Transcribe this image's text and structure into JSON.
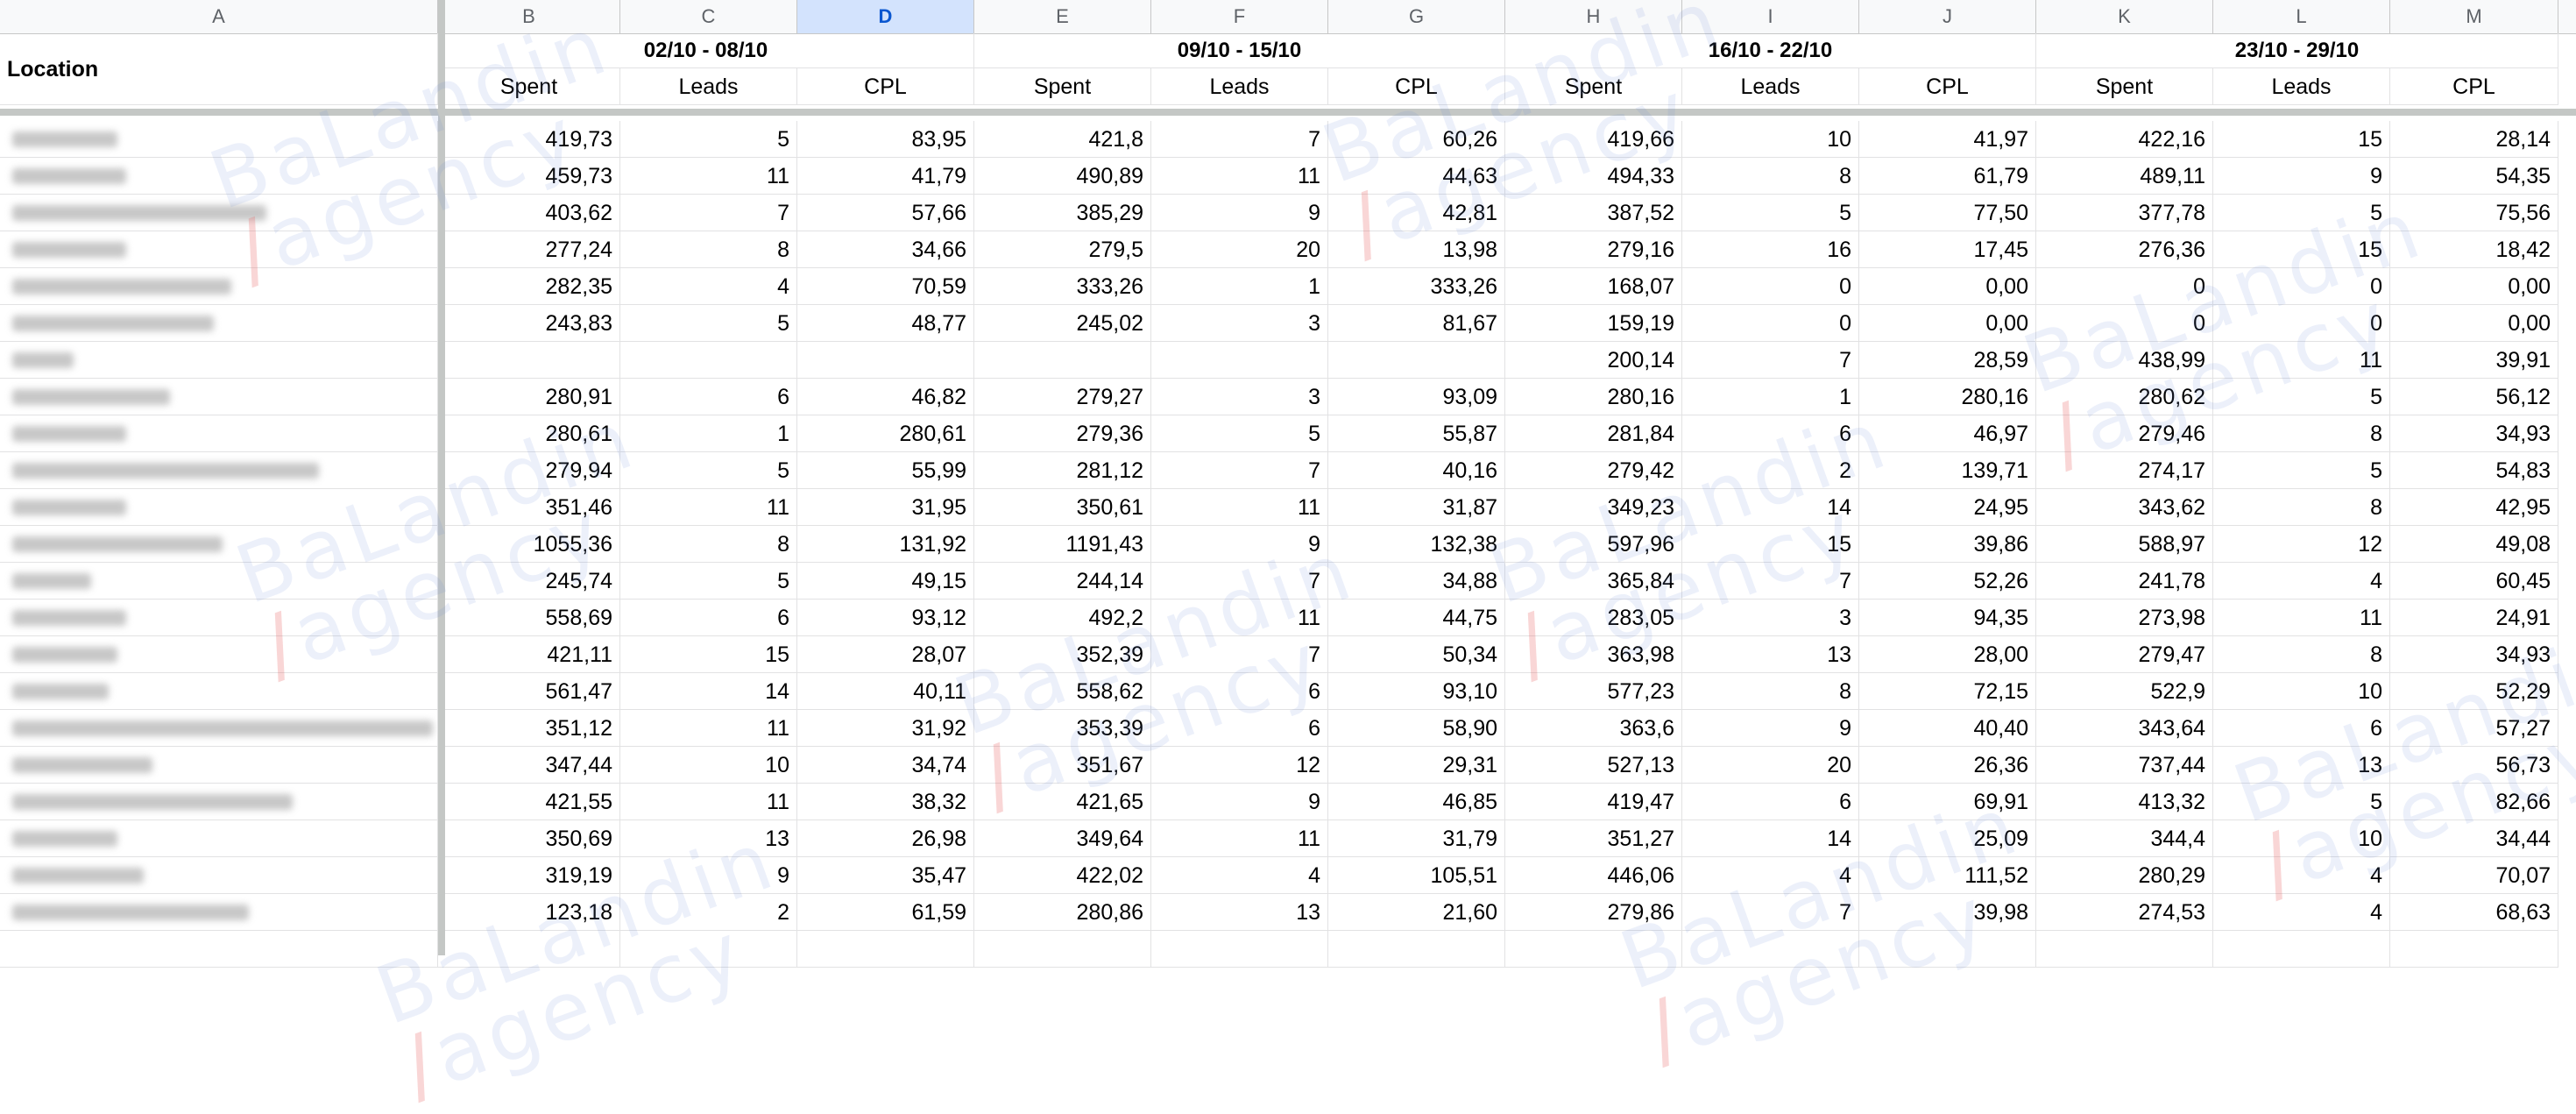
{
  "columns": [
    "A",
    "B",
    "C",
    "D",
    "E",
    "F",
    "G",
    "H",
    "I",
    "J",
    "K",
    "L",
    "M"
  ],
  "selected_column": "D",
  "header": {
    "location_label": "Location",
    "weeks": [
      "02/10 - 08/10",
      "09/10 - 15/10",
      "16/10 - 22/10",
      "23/10 - 29/10"
    ],
    "sub": [
      "Spent",
      "Leads",
      "CPL"
    ]
  },
  "rows": [
    [
      "419,73",
      "5",
      "83,95",
      "421,8",
      "7",
      "60,26",
      "419,66",
      "10",
      "41,97",
      "422,16",
      "15",
      "28,14"
    ],
    [
      "459,73",
      "11",
      "41,79",
      "490,89",
      "11",
      "44,63",
      "494,33",
      "8",
      "61,79",
      "489,11",
      "9",
      "54,35"
    ],
    [
      "403,62",
      "7",
      "57,66",
      "385,29",
      "9",
      "42,81",
      "387,52",
      "5",
      "77,50",
      "377,78",
      "5",
      "75,56"
    ],
    [
      "277,24",
      "8",
      "34,66",
      "279,5",
      "20",
      "13,98",
      "279,16",
      "16",
      "17,45",
      "276,36",
      "15",
      "18,42"
    ],
    [
      "282,35",
      "4",
      "70,59",
      "333,26",
      "1",
      "333,26",
      "168,07",
      "0",
      "0,00",
      "0",
      "0",
      "0,00"
    ],
    [
      "243,83",
      "5",
      "48,77",
      "245,02",
      "3",
      "81,67",
      "159,19",
      "0",
      "0,00",
      "0",
      "0",
      "0,00"
    ],
    [
      "",
      "",
      "",
      "",
      "",
      "",
      "200,14",
      "7",
      "28,59",
      "438,99",
      "11",
      "39,91"
    ],
    [
      "280,91",
      "6",
      "46,82",
      "279,27",
      "3",
      "93,09",
      "280,16",
      "1",
      "280,16",
      "280,62",
      "5",
      "56,12"
    ],
    [
      "280,61",
      "1",
      "280,61",
      "279,36",
      "5",
      "55,87",
      "281,84",
      "6",
      "46,97",
      "279,46",
      "8",
      "34,93"
    ],
    [
      "279,94",
      "5",
      "55,99",
      "281,12",
      "7",
      "40,16",
      "279,42",
      "2",
      "139,71",
      "274,17",
      "5",
      "54,83"
    ],
    [
      "351,46",
      "11",
      "31,95",
      "350,61",
      "11",
      "31,87",
      "349,23",
      "14",
      "24,95",
      "343,62",
      "8",
      "42,95"
    ],
    [
      "1055,36",
      "8",
      "131,92",
      "1191,43",
      "9",
      "132,38",
      "597,96",
      "15",
      "39,86",
      "588,97",
      "12",
      "49,08"
    ],
    [
      "245,74",
      "5",
      "49,15",
      "244,14",
      "7",
      "34,88",
      "365,84",
      "7",
      "52,26",
      "241,78",
      "4",
      "60,45"
    ],
    [
      "558,69",
      "6",
      "93,12",
      "492,2",
      "11",
      "44,75",
      "283,05",
      "3",
      "94,35",
      "273,98",
      "11",
      "24,91"
    ],
    [
      "421,11",
      "15",
      "28,07",
      "352,39",
      "7",
      "50,34",
      "363,98",
      "13",
      "28,00",
      "279,47",
      "8",
      "34,93"
    ],
    [
      "561,47",
      "14",
      "40,11",
      "558,62",
      "6",
      "93,10",
      "577,23",
      "8",
      "72,15",
      "522,9",
      "10",
      "52,29"
    ],
    [
      "351,12",
      "11",
      "31,92",
      "353,39",
      "6",
      "58,90",
      "363,6",
      "9",
      "40,40",
      "343,64",
      "6",
      "57,27"
    ],
    [
      "347,44",
      "10",
      "34,74",
      "351,67",
      "12",
      "29,31",
      "527,13",
      "20",
      "26,36",
      "737,44",
      "13",
      "56,73"
    ],
    [
      "421,55",
      "11",
      "38,32",
      "421,65",
      "9",
      "46,85",
      "419,47",
      "6",
      "69,91",
      "413,32",
      "5",
      "82,66"
    ],
    [
      "350,69",
      "13",
      "26,98",
      "349,64",
      "11",
      "31,79",
      "351,27",
      "14",
      "25,09",
      "344,4",
      "10",
      "34,44"
    ],
    [
      "319,19",
      "9",
      "35,47",
      "422,02",
      "4",
      "105,51",
      "446,06",
      "4",
      "111,52",
      "280,29",
      "4",
      "70,07"
    ],
    [
      "123,18",
      "2",
      "61,59",
      "280,86",
      "13",
      "21,60",
      "279,86",
      "7",
      "39,98",
      "274,53",
      "4",
      "68,63"
    ]
  ],
  "watermark": {
    "line1": "BaLandin",
    "slash": "/",
    "line2": "agency"
  }
}
